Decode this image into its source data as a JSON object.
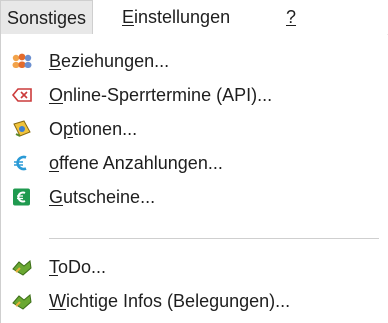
{
  "menubar": {
    "items": [
      {
        "label": "Sonstiges",
        "accel_prefix": "",
        "accel": "",
        "rest": "Sonstiges"
      },
      {
        "label": "Einstellungen",
        "accel_prefix": "",
        "accel": "E",
        "rest": "instellungen"
      },
      {
        "label": "?",
        "accel_prefix": "",
        "accel": "?",
        "rest": ""
      }
    ]
  },
  "menu": {
    "items": [
      {
        "label": "Beziehungen...",
        "pre": "",
        "accel": "B",
        "rest": "eziehungen...",
        "icon": "people-icon"
      },
      {
        "label": "Online-Sperrtermine (API)...",
        "pre": "",
        "accel": "O",
        "rest": "nline-Sperrtermine (API)...",
        "icon": "blocked-dates-icon"
      },
      {
        "label": "Optionen...",
        "pre": "O",
        "accel": "p",
        "rest": "tionen...",
        "icon": "options-icon"
      },
      {
        "label": "offene Anzahlungen...",
        "pre": "",
        "accel": "o",
        "rest": "ffene Anzahlungen...",
        "icon": "euro-icon"
      },
      {
        "label": "Gutscheine...",
        "pre": "",
        "accel": "G",
        "rest": "utscheine...",
        "icon": "voucher-euro-icon"
      },
      {
        "label": "ToDo...",
        "pre": "",
        "accel": "T",
        "rest": "oDo...",
        "icon": "todo-icon"
      },
      {
        "label": "Wichtige Infos (Belegungen)...",
        "pre": "",
        "accel": "W",
        "rest": "ichtige Infos (Belegungen)...",
        "icon": "important-info-icon"
      }
    ]
  }
}
